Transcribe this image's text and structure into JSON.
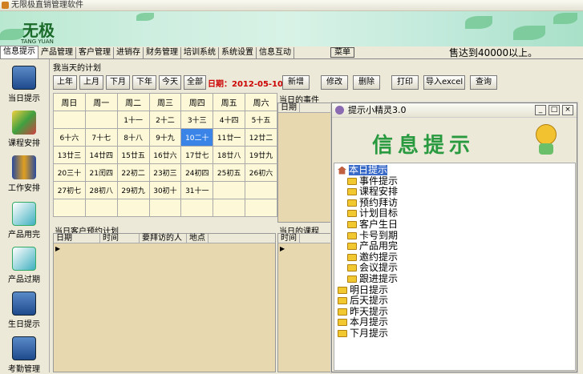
{
  "window": {
    "title": "无限极直销管理软件"
  },
  "banner": {
    "logo_text": "无极",
    "logo_sub": "TANG YUAN"
  },
  "tabs": [
    "信息提示",
    "产品管理",
    "客户管理",
    "进销存",
    "财务管理",
    "培训系统",
    "系统设置",
    "信息互动"
  ],
  "menu_label": "菜单",
  "marquee": "售达到40000以上。",
  "sidebar": [
    "当日提示",
    "课程安排",
    "工作安排",
    "产品用完",
    "产品过期",
    "生日提示",
    "考勤管理"
  ],
  "plan": {
    "group_title": "我当天的计划",
    "nav": [
      "上年",
      "上月",
      "下月",
      "下年",
      "今天",
      "全部"
    ],
    "date_label": "日期：2012-05-10",
    "actions": [
      "新增",
      "修改",
      "删除",
      "打印",
      "导入excel",
      "查询"
    ]
  },
  "calendar": {
    "headers": [
      "周日",
      "周一",
      "周二",
      "周三",
      "周四",
      "周五",
      "周六"
    ],
    "rows": [
      [
        "",
        "",
        "1十一",
        "2十二",
        "3十三",
        "4十四",
        "5十五"
      ],
      [
        "6十六",
        "7十七",
        "8十八",
        "9十九",
        "10二十",
        "11廿一",
        "12廿二"
      ],
      [
        "13廿三",
        "14廿四",
        "15廿五",
        "16廿六",
        "17廿七",
        "18廿八",
        "19廿九"
      ],
      [
        "20三十",
        "21闰四",
        "22初二",
        "23初三",
        "24初四",
        "25初五",
        "26初六"
      ],
      [
        "27初七",
        "28初八",
        "29初九",
        "30初十",
        "31十一",
        "",
        ""
      ],
      [
        "",
        "",
        "",
        "",
        "",
        "",
        ""
      ]
    ],
    "selected": "10二十"
  },
  "events_panel": {
    "title": "当日的事件",
    "columns": [
      "日期"
    ]
  },
  "visits_panel": {
    "title": "当日客户预约计划",
    "columns": [
      "日期",
      "时间",
      "要拜访的人",
      "地点"
    ]
  },
  "courses_panel": {
    "title": "当日的课程",
    "columns": [
      "时间"
    ]
  },
  "popup": {
    "title": "提示小精灵3.0",
    "heading": "信息提示",
    "tree": {
      "root": "本日提示",
      "children": [
        "事件提示",
        "课程安排",
        "预约拜访",
        "计划目标",
        "客户生日",
        "卡号到期",
        "产品用完",
        "邀约提示",
        "会议提示",
        "跟进提示"
      ],
      "others": [
        "明日提示",
        "后天提示",
        "昨天提示",
        "本月提示",
        "下月提示"
      ]
    }
  },
  "colors": {
    "accent": "#3a84e8",
    "panel": "#e8d8b0",
    "calendar": "#fdf8d8",
    "heading_green": "#2a9a40",
    "date_red": "#cc0000"
  }
}
